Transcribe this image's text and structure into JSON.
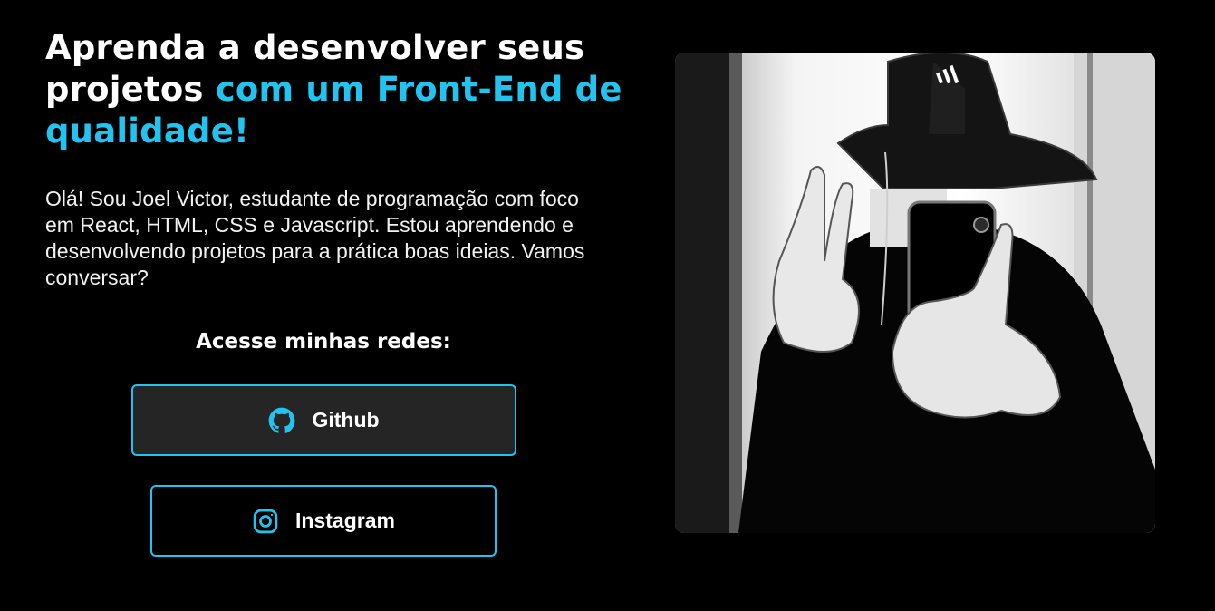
{
  "hero": {
    "headline_part1": "Aprenda a desenvolver seus projetos ",
    "headline_part2": "com um Front-End de qualidade!",
    "bio": "Olá! Sou Joel Victor, estudante de programação com foco em React, HTML, CSS e Javascript. Estou aprendendo e desenvolvendo projetos para a prática boas ideias. Vamos conversar?"
  },
  "networks": {
    "title": "Acesse minhas redes:",
    "buttons": [
      {
        "label": "Github",
        "icon": "github-icon"
      },
      {
        "label": "Instagram",
        "icon": "instagram-icon"
      }
    ]
  },
  "portrait": {
    "alt": "Ilustração em preto e branco de uma pessoa com chapéu bucket tirando selfie e fazendo sinal de paz"
  },
  "colors": {
    "background": "#000000",
    "accent": "#22c3ee",
    "text": "#ffffff",
    "button_fill": "#252525"
  }
}
